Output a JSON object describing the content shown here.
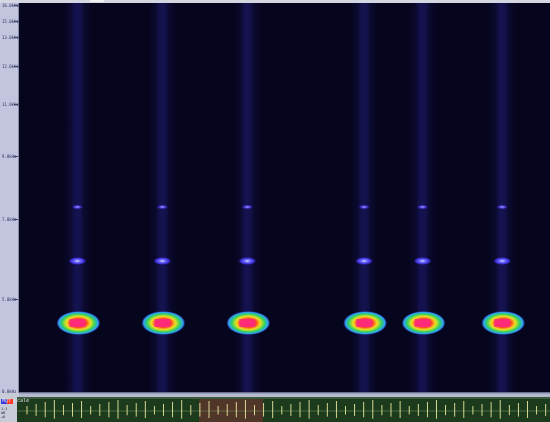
{
  "freq_axis": {
    "tick_labels": [
      "16.0kHz",
      "15.0kHz",
      "13.0kHz",
      "12.0kHz",
      "11.0kHz",
      "9.0kHz",
      "7.0kHz",
      "5.0kHz",
      "0.0kHz"
    ]
  },
  "spectrogram": {
    "colormap": [
      "#06051e",
      "#1a1a6e",
      "#3a3adf",
      "#2fa0ff",
      "#2fd060",
      "#f0e020",
      "#ff3a20",
      "#ff2a80"
    ],
    "calls": [
      {
        "time": 0.11
      },
      {
        "time": 0.27
      },
      {
        "time": 0.43
      },
      {
        "time": 0.65
      },
      {
        "time": 0.76
      },
      {
        "time": 0.91
      }
    ]
  },
  "nav": {
    "track_name": "Mgt scale",
    "left_labels": [
      "1:1",
      "dB",
      "+8"
    ],
    "highlight_color": "#b03040",
    "waveform_color": "#e8e8a0",
    "background_color": "#1c3a1c"
  }
}
